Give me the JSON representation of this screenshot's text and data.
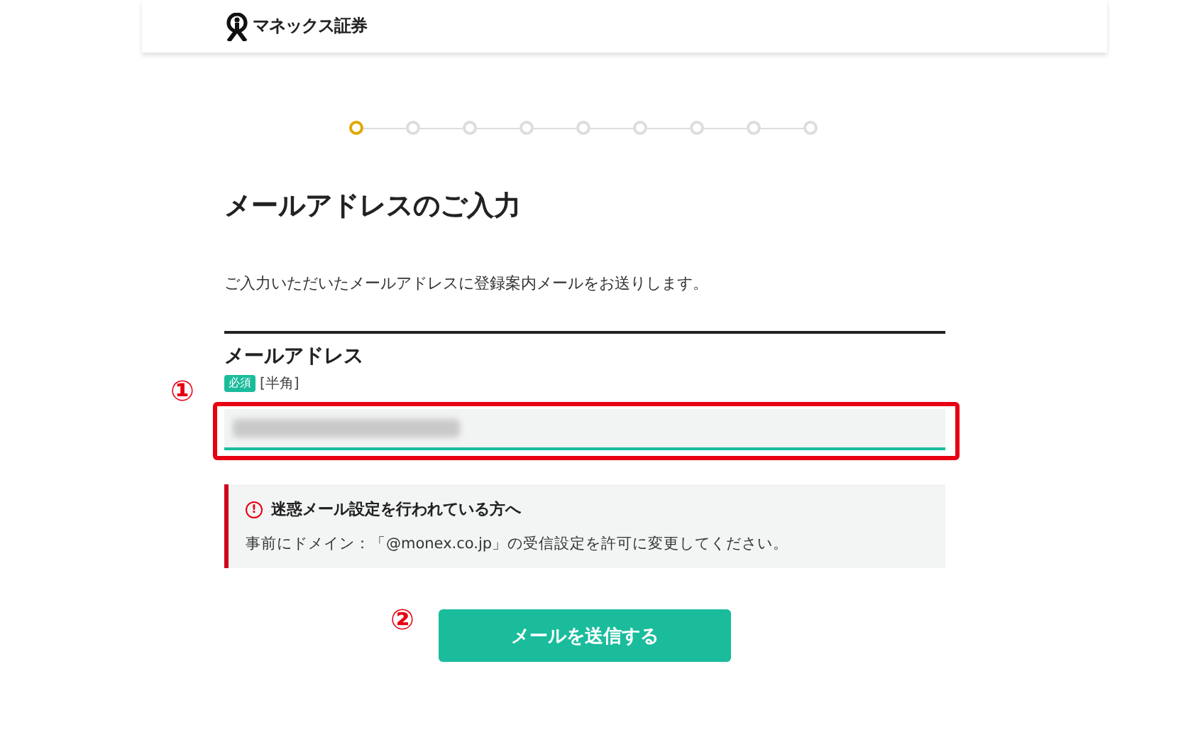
{
  "header": {
    "logo_text": "マネックス証券"
  },
  "steps": [
    {
      "selected": true
    },
    {
      "selected": false
    },
    {
      "selected": false
    },
    {
      "selected": false
    },
    {
      "selected": false
    },
    {
      "selected": false
    },
    {
      "selected": false
    },
    {
      "selected": false
    },
    {
      "selected": false
    }
  ],
  "title": "メールアドレスのご入力",
  "description": "ご入力いただいたメールアドレスに登録案内メールをお送りします。",
  "field": {
    "label": "メールアドレス",
    "required_badge": "必須",
    "hint": "[半角]",
    "annotation": "①"
  },
  "notice": {
    "icon_text": "!",
    "title": "迷惑メール設定を行われている方へ",
    "body": "事前にドメイン：「@monex.co.jp」の受信設定を許可に変更してください。"
  },
  "submit": {
    "label": "メールを送信する",
    "annotation": "②"
  }
}
